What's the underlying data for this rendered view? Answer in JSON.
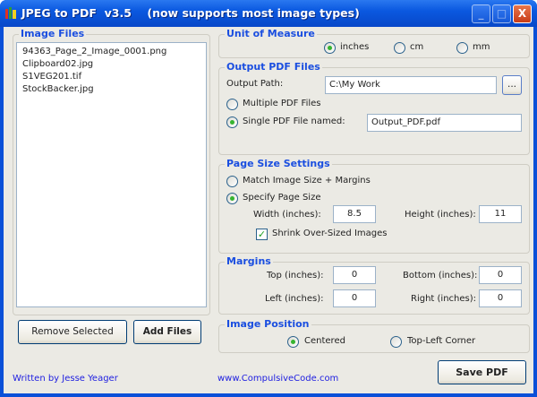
{
  "window": {
    "title": "JPEG to PDF  v3.5    (now supports most image types)",
    "buttons": {
      "minimize": "_",
      "maximize": "□",
      "close": "X"
    }
  },
  "image_files": {
    "label": "Image Files",
    "items": [
      "94363_Page_2_Image_0001.png",
      "Clipboard02.jpg",
      "S1VEG201.tif",
      "StockBacker.jpg"
    ],
    "remove_label": "Remove Selected",
    "add_label": "Add Files"
  },
  "unit": {
    "label": "Unit of Measure",
    "options": [
      "inches",
      "cm",
      "mm"
    ],
    "selected": "inches"
  },
  "output": {
    "label": "Output PDF Files",
    "path_label": "Output Path:",
    "path_value": "C:\\My Work",
    "browse_label": "...",
    "multiple_label": "Multiple PDF Files",
    "single_label": "Single PDF File named:",
    "single_value": "Output_PDF.pdf",
    "selected": "single"
  },
  "page_size": {
    "label": "Page Size Settings",
    "match_label": "Match Image Size + Margins",
    "specify_label": "Specify Page Size",
    "selected": "specify",
    "width_label": "Width (inches):",
    "width_value": "8.5",
    "height_label": "Height (inches):",
    "height_value": "11",
    "shrink_label": "Shrink Over-Sized Images",
    "shrink_checked": true
  },
  "margins": {
    "label": "Margins",
    "top_label": "Top (inches):",
    "top_value": "0",
    "bottom_label": "Bottom (inches):",
    "bottom_value": "0",
    "left_label": "Left (inches):",
    "left_value": "0",
    "right_label": "Right (inches):",
    "right_value": "0"
  },
  "position": {
    "label": "Image Position",
    "centered_label": "Centered",
    "topleft_label": "Top-Left Corner",
    "selected": "centered"
  },
  "footer": {
    "author": "Written by Jesse Yeager",
    "website": "www.CompulsiveCode.com",
    "save_label": "Save PDF"
  }
}
